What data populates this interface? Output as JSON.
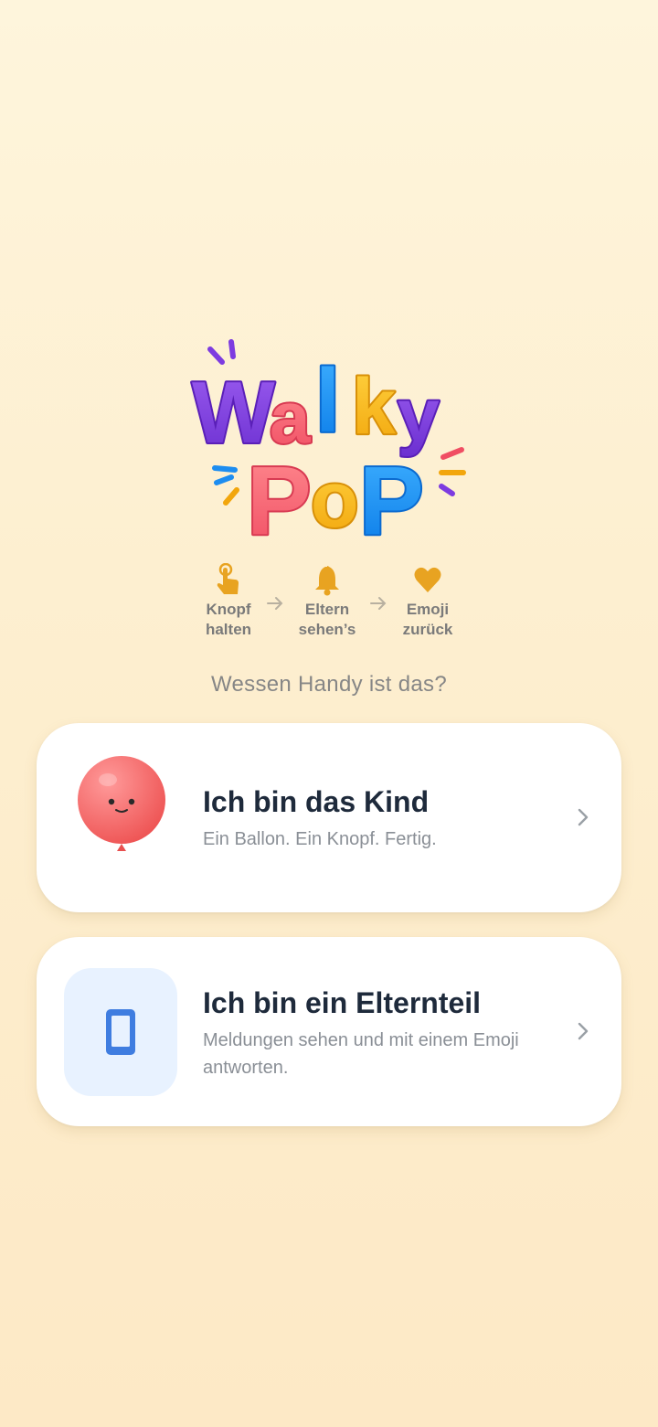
{
  "app": {
    "logo_text": [
      "Walky",
      "Pop"
    ]
  },
  "steps": [
    {
      "icon": "tap-hand-icon",
      "label": "Knopf\nhalten"
    },
    {
      "icon": "bell-icon",
      "label": "Eltern\nsehen’s"
    },
    {
      "icon": "heart-icon",
      "label": "Emoji\nzurück"
    }
  ],
  "question": "Wessen Handy ist das?",
  "options": {
    "child": {
      "title": "Ich bin das Kind",
      "subtitle": "Ein Ballon. Ein Knopf. Fertig."
    },
    "parent": {
      "title": "Ich bin ein Elternteil",
      "subtitle": "Meldungen sehen und mit einem Emoji antworten."
    }
  },
  "colors": {
    "accent_orange": "#e8a321",
    "title": "#1e2a3b",
    "balloon": "#f56c6c",
    "phone": "#3f7de0"
  }
}
